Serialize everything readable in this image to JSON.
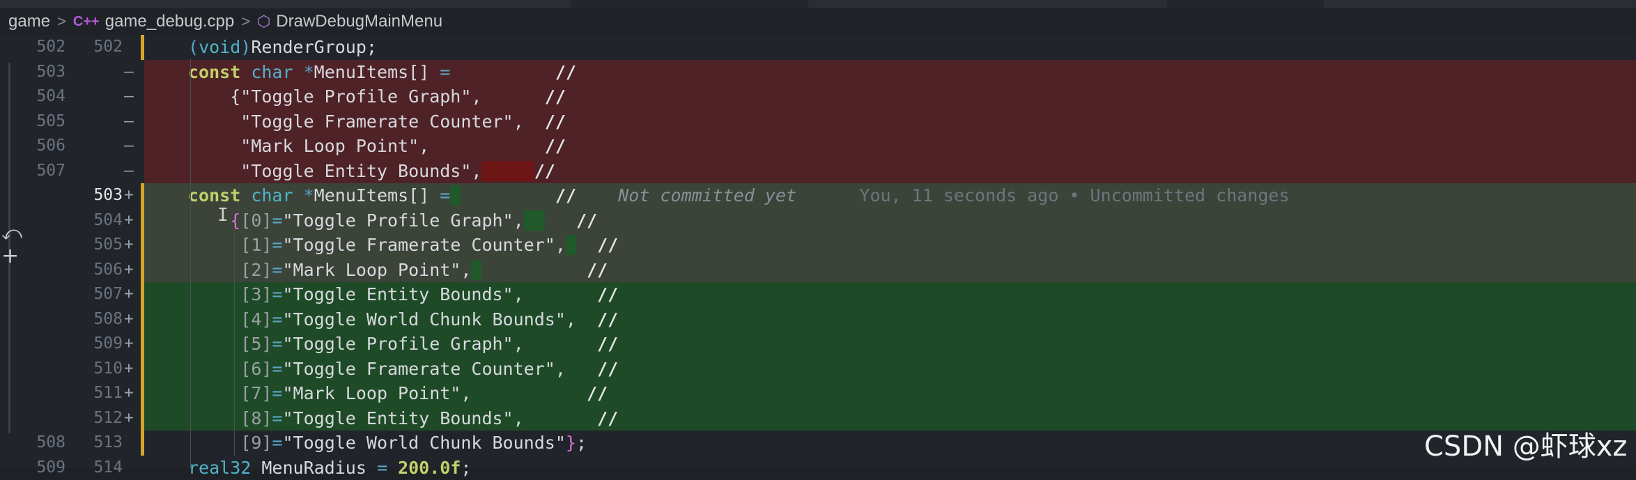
{
  "breadcrumb": {
    "item1": "game",
    "item2": "game_debug.cpp",
    "item3": "DrawDebugMainMenu",
    "sep": ">",
    "cpp_icon": "C++",
    "cube_icon": "⬡"
  },
  "colors": {
    "removed_bg": "#4f2228",
    "added_bg": "#1f4a27",
    "uncommitted_bg": "#3c4339",
    "modified_bar": "#d4a72c"
  },
  "diff": {
    "lines": [
      {
        "old": "502",
        "new": "502",
        "sign": "",
        "kind": "context",
        "text": "(void)RenderGroup;"
      },
      {
        "old": "503",
        "new": "",
        "sign": "—",
        "kind": "removed",
        "text": "const char *MenuItems[] =          //"
      },
      {
        "old": "504",
        "new": "",
        "sign": "—",
        "kind": "removed",
        "text": "{\"Toggle Profile Graph\",      //"
      },
      {
        "old": "505",
        "new": "",
        "sign": "—",
        "kind": "removed",
        "text": "\"Toggle Framerate Counter\",  //"
      },
      {
        "old": "506",
        "new": "",
        "sign": "—",
        "kind": "removed",
        "text": "\"Mark Loop Point\",           //"
      },
      {
        "old": "507",
        "new": "",
        "sign": "—",
        "kind": "removed",
        "text": "\"Toggle Entity Bounds\",     //"
      },
      {
        "old": "",
        "new": "503",
        "sign": "+",
        "kind": "uncommitted",
        "text": "const char *MenuItems[] =          //"
      },
      {
        "old": "",
        "new": "504",
        "sign": "+",
        "kind": "uncommitted",
        "text": "{[0]=\"Toggle Profile Graph\",      //"
      },
      {
        "old": "",
        "new": "505",
        "sign": "+",
        "kind": "uncommitted",
        "text": "[1]=\"Toggle Framerate Counter\",   //"
      },
      {
        "old": "",
        "new": "506",
        "sign": "+",
        "kind": "uncommitted",
        "text": "[2]=\"Mark Loop Point\",           //"
      },
      {
        "old": "",
        "new": "507",
        "sign": "+",
        "kind": "added",
        "text": "[3]=\"Toggle Entity Bounds\",       //"
      },
      {
        "old": "",
        "new": "508",
        "sign": "+",
        "kind": "added",
        "text": "[4]=\"Toggle World Chunk Bounds\",  //"
      },
      {
        "old": "",
        "new": "509",
        "sign": "+",
        "kind": "added",
        "text": "[5]=\"Toggle Profile Graph\",       //"
      },
      {
        "old": "",
        "new": "510",
        "sign": "+",
        "kind": "added",
        "text": "[6]=\"Toggle Framerate Counter\",   //"
      },
      {
        "old": "",
        "new": "511",
        "sign": "+",
        "kind": "added",
        "text": "[7]=\"Mark Loop Point\",           //"
      },
      {
        "old": "",
        "new": "512",
        "sign": "+",
        "kind": "added",
        "text": "[8]=\"Toggle Entity Bounds\",       //"
      },
      {
        "old": "508",
        "new": "513",
        "sign": "",
        "kind": "context",
        "text": "[9]=\"Toggle World Chunk Bounds\"};"
      },
      {
        "old": "509",
        "new": "514",
        "sign": "",
        "kind": "context",
        "text": "real32 MenuRadius = 200.0f;"
      }
    ],
    "blame": {
      "not_committed": "Not committed yet",
      "author_time": "You, 11 seconds ago • Uncommitted changes"
    }
  },
  "watermark": "CSDN @虾球xz"
}
